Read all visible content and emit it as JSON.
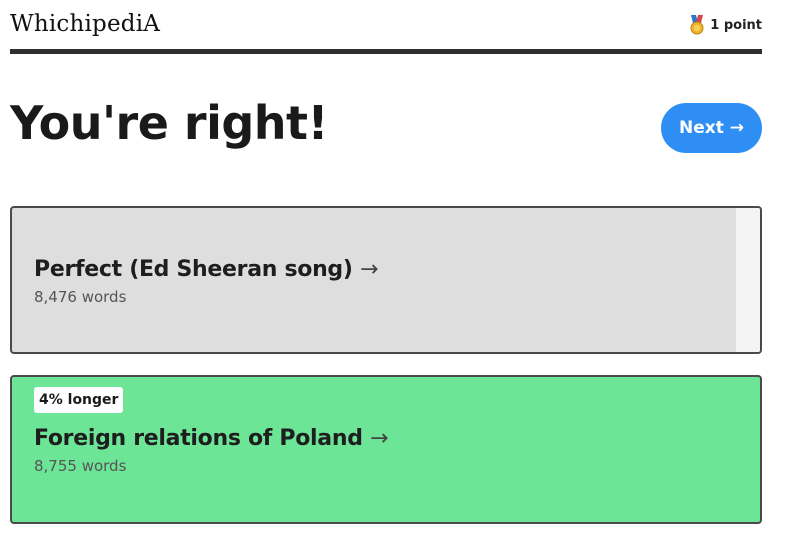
{
  "header": {
    "logo": "WhichipediA",
    "score_text": "1 point",
    "score_icon": "medal-icon"
  },
  "result": {
    "title": "You're right!",
    "next_label": "Next →"
  },
  "cards": [
    {
      "title": "Perfect (Ed Sheeran song)",
      "arrow": "→",
      "words": "8,476 words",
      "length_ratio": 0.968,
      "color": "#dedede"
    },
    {
      "badge": "4% longer",
      "title": "Foreign relations of Poland",
      "arrow": "→",
      "words": "8,755 words",
      "color": "#6de597"
    }
  ],
  "colors": {
    "accent": "#2f8ef4",
    "correct": "#6de597",
    "rule": "#2f2f2f"
  }
}
